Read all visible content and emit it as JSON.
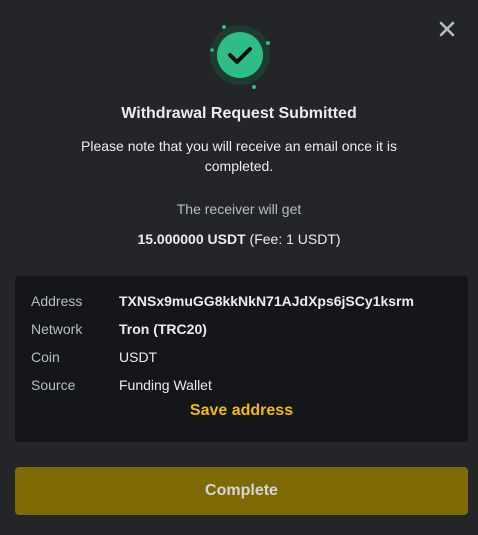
{
  "dialog": {
    "title": "Withdrawal Request Submitted",
    "note": "Please note that you will receive an email once it is completed.",
    "receiver_label": "The receiver will get",
    "amount": "15.000000 USDT",
    "fee": "(Fee: 1 USDT)"
  },
  "details": {
    "rows": [
      {
        "label": "Address",
        "value": "TXNSx9muGG8kkNkN71AJdXps6jSCy1ksrm"
      },
      {
        "label": "Network",
        "value": "Tron (TRC20)"
      },
      {
        "label": "Coin",
        "value": "USDT"
      },
      {
        "label": "Source",
        "value": "Funding Wallet"
      }
    ],
    "save_address_label": "Save address"
  },
  "actions": {
    "complete_label": "Complete"
  },
  "icons": {
    "close": "close-icon",
    "success": "check-circle-icon"
  },
  "colors": {
    "background": "#242528",
    "panel": "#151619",
    "accent": "#f0b90b",
    "success": "#2ebd85",
    "button": "#7f6a05"
  }
}
